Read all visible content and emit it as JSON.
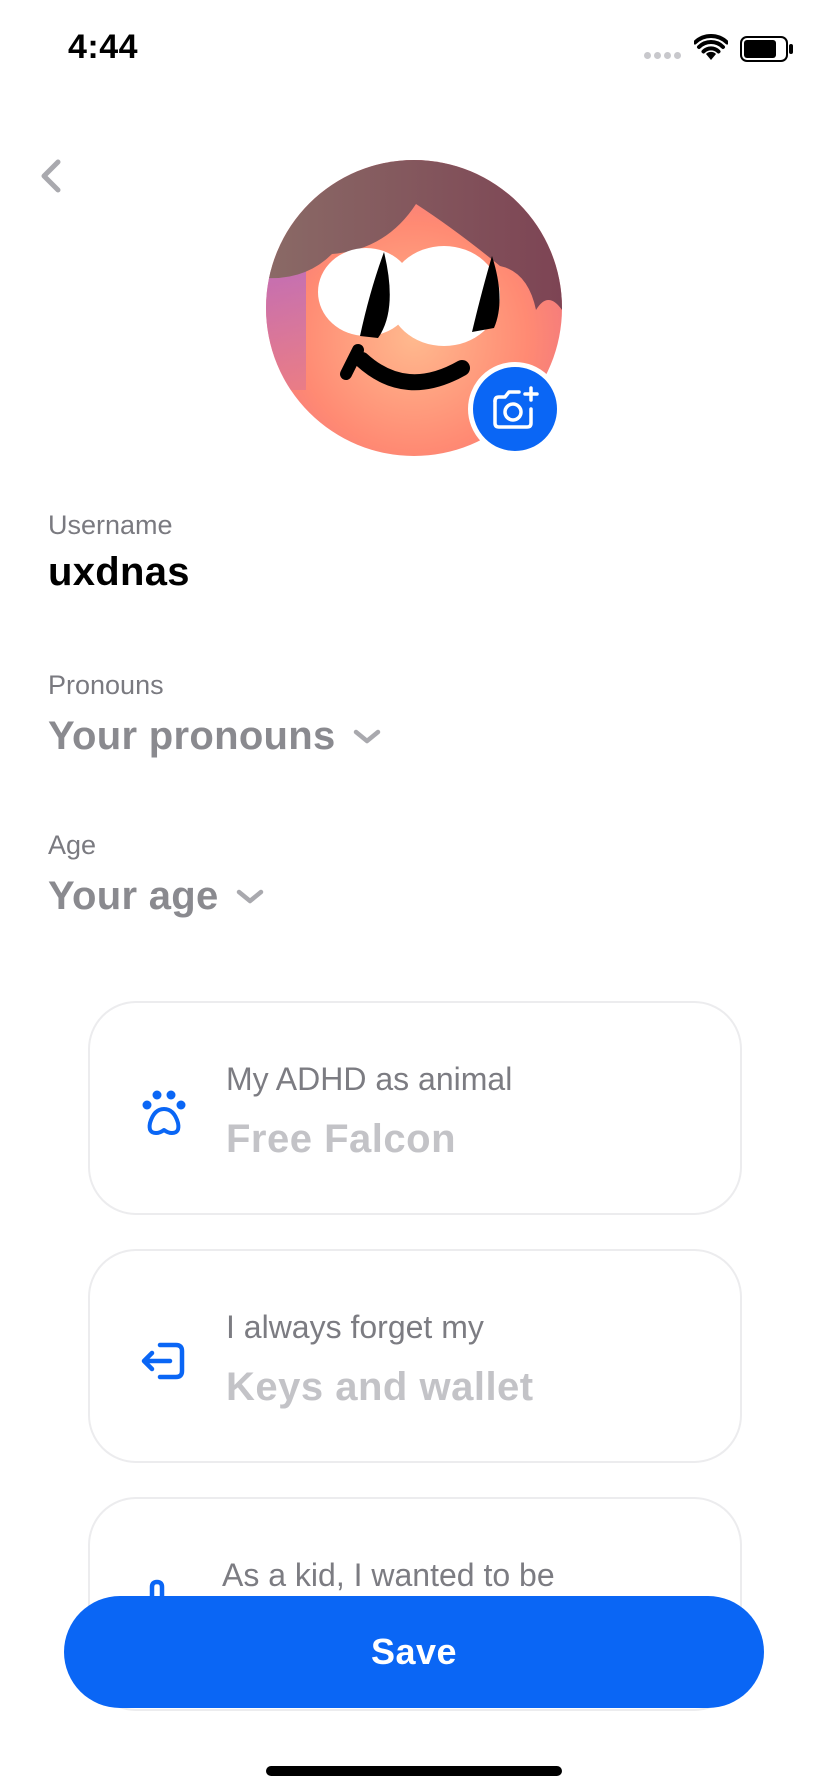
{
  "status_bar": {
    "time": "4:44",
    "battery_level": 0.8
  },
  "profile": {
    "username_label": "Username",
    "username_value": "uxdnas",
    "pronouns_label": "Pronouns",
    "pronouns_placeholder": "Your pronouns",
    "age_label": "Age",
    "age_placeholder": "Your age"
  },
  "cards": [
    {
      "icon": "paw-icon",
      "label": "My ADHD as animal",
      "value": "Free Falcon"
    },
    {
      "icon": "exit-icon",
      "label": "I always forget my",
      "value": "Keys and wallet"
    },
    {
      "icon": "hand-icon",
      "label": "As a kid, I wanted to be",
      "value": ""
    }
  ],
  "actions": {
    "save_label": "Save"
  },
  "colors": {
    "accent": "#0A66F5",
    "muted_text": "#8A8A8F",
    "placeholder_value": "#C3C3C7"
  }
}
